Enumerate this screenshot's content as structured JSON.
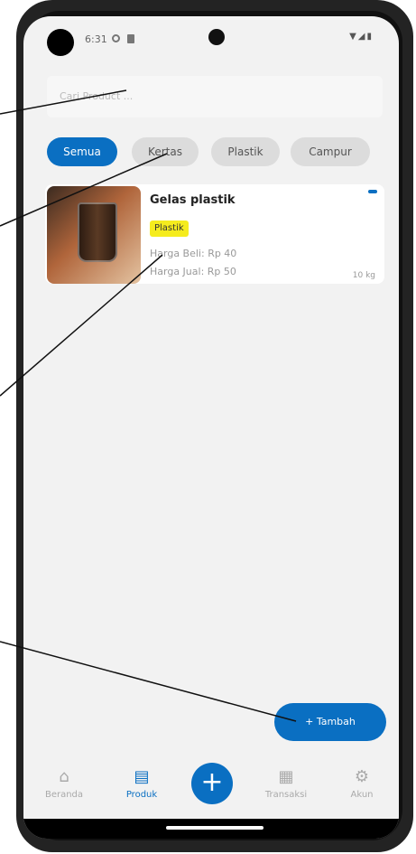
{
  "status": {
    "time": "6:31"
  },
  "search": {
    "placeholder": "Cari Product ..."
  },
  "filters": [
    "Semua",
    "Kertas",
    "Plastik",
    "Campur"
  ],
  "product": {
    "name": "Gelas plastik",
    "tag": "Plastik",
    "buy_price": "Harga Beli: Rp 40",
    "sell_price": "Harga Jual: Rp 50",
    "weight": "10 kg"
  },
  "fab": {
    "label": "+ Tambah"
  },
  "nav": {
    "items": [
      "Beranda",
      "Produk",
      "Transaksi",
      "Akun"
    ],
    "center_label": "+"
  },
  "colors": {
    "accent": "#0a6fc2",
    "tag": "#f5ec1e"
  }
}
